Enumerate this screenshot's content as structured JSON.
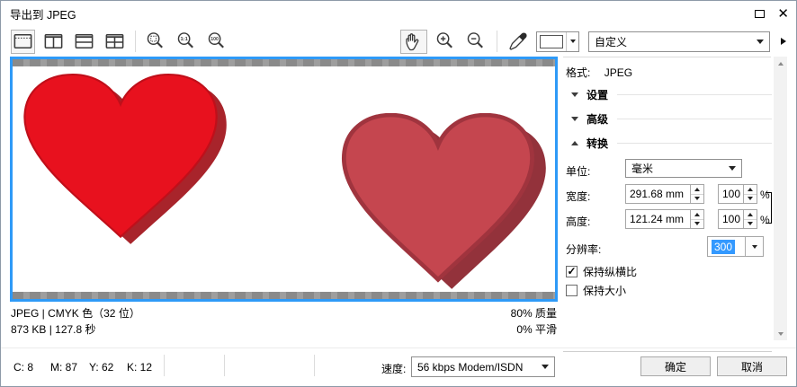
{
  "window": {
    "title": "导出到 JPEG"
  },
  "titlebar": {
    "maximize_icon": "▢",
    "close_icon": "✕"
  },
  "toolbar": {
    "preset_label": "自定义",
    "icons": {
      "preview_full": "single-pane",
      "preview_two_vertical": "two-vertical-panes",
      "preview_two_horizontal": "two-horizontal-panes",
      "preview_four": "four-panes",
      "zoom_to_fit": "magnifier-dotted",
      "zoom_1to1": "1:1",
      "zoom_100": "100",
      "hand": "pan-hand",
      "zoom_in": "magnifier-plus",
      "zoom_out": "magnifier-minus",
      "eyedropper": "eyedropper",
      "matte_swatch": "white-swatch",
      "flyout": "▶"
    }
  },
  "preview": {
    "info_left_line1": "JPEG | CMYK 色（32 位）",
    "info_right_line1": "80% 质量",
    "info_left_line2": "873 KB | 127.8 秒",
    "info_right_line2": "0% 平滑"
  },
  "panel": {
    "format_label": "格式:",
    "format_value": "JPEG",
    "sections": [
      {
        "label": "设置",
        "state": "collapsed"
      },
      {
        "label": "高级",
        "state": "collapsed"
      },
      {
        "label": "转换",
        "state": "expanded"
      }
    ],
    "unit_label": "单位:",
    "unit_value": "毫米",
    "width_label": "宽度:",
    "width_value": "291.68 mm",
    "width_percent": "100",
    "height_label": "高度:",
    "height_value": "121.24 mm",
    "height_percent": "100",
    "percent_sign": "%",
    "resolution_label": "分辨率:",
    "resolution_value": "300",
    "checkbox_aspect": {
      "label": "保持纵横比",
      "checked": true,
      "glyph": "✓"
    },
    "checkbox_size": {
      "label": "保持大小",
      "checked": false,
      "glyph": ""
    }
  },
  "statusbar": {
    "c": "C: 8",
    "m": "M: 87",
    "y": "Y: 62",
    "k": "K: 12",
    "speed_label": "速度:",
    "speed_value": "56 kbps Modem/ISDN",
    "ok_label": "确定",
    "cancel_label": "取消"
  },
  "colors": {
    "preview_border": "#2e9af7",
    "heart1_fill": "#e8111e",
    "heart1_shadow": "#a8242b",
    "heart2_fill": "#c5464f",
    "heart2_shadow": "#93323b",
    "selection_bg": "#3399ff"
  }
}
